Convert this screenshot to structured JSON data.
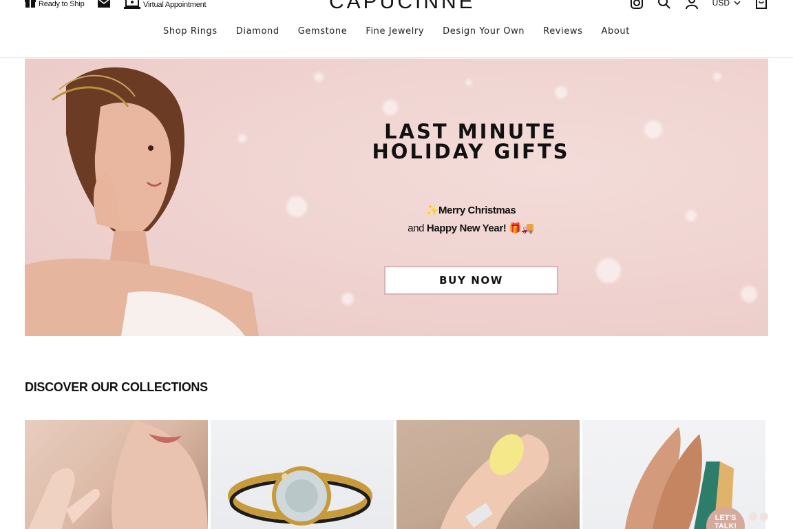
{
  "header": {
    "utility": {
      "ready_to_ship": "Ready to Ship",
      "virtual_appointment": "Virtual Appointment"
    },
    "logo": "CAPUCINNE",
    "currency": "USD",
    "icons": [
      "mail-icon",
      "instagram-icon",
      "search-icon",
      "account-icon",
      "cart-icon"
    ]
  },
  "nav": {
    "items": [
      "Shop Rings",
      "Diamond",
      "Gemstone",
      "Fine Jewelry",
      "Design Your Own",
      "Reviews",
      "About"
    ]
  },
  "hero": {
    "title": "LAST MINUTE HOLIDAY GIFTS",
    "sparkle": "✨",
    "merry": "Merry Christmas",
    "and": "and ",
    "happy": "Happy New Year!",
    "emoji": "🎁🚚",
    "cta": "BUY NOW",
    "background_color": "#efd2cf"
  },
  "collections": {
    "prefix": "DISCOVER ",
    "title": "OUR COLLECTIONS"
  },
  "chat": {
    "label_line1": "LET'S",
    "label_line2": "TALK!"
  },
  "colors": {
    "accent_border": "#d9b3b0",
    "chat_bubble": "#d6a99d"
  }
}
